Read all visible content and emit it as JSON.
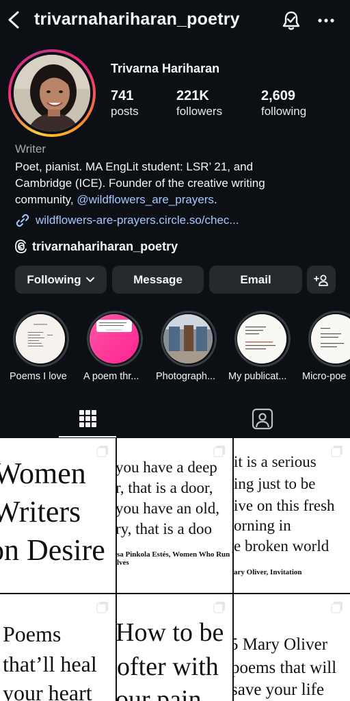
{
  "header": {
    "username": "trivarnahariharan_poetry"
  },
  "profile": {
    "display_name": "Trivarna Hariharan",
    "stats": [
      {
        "value": "741",
        "label": "posts"
      },
      {
        "value": "221K",
        "label": "followers"
      },
      {
        "value": "2,609",
        "label": "following"
      }
    ],
    "category": "Writer",
    "bio_lines": [
      "Poet, pianist. MA EngLit student: LSR’ 21, and",
      "Cambridge (ICE). Founder of the creative writing",
      "community, "
    ],
    "bio_mention": "@wildflowers_are_prayers",
    "bio_end": ".",
    "link": "wildflowers-are-prayers.circle.so/chec...",
    "threads_handle": "trivarnahariharan_poetry"
  },
  "actions": {
    "following": "Following",
    "message": "Message",
    "email": "Email"
  },
  "highlights": [
    {
      "label": "Poems I love"
    },
    {
      "label": "A poem thr..."
    },
    {
      "label": "Photograph..."
    },
    {
      "label": "My publicat..."
    },
    {
      "label": "Micro-poe"
    }
  ],
  "posts": [
    {
      "lines": [
        "Women",
        "Writers",
        "on Desire"
      ],
      "caption": ""
    },
    {
      "lines": [
        "you have a deep",
        "r, that is a door,",
        "you have an old,",
        "ry, that is a doo"
      ],
      "caption": "sa Pinkola Estés, Women Who Run Wit",
      "caption2": "lves"
    },
    {
      "lines": [
        "it is a serious",
        "ing just to be",
        "ive on this fresh",
        "orning in",
        "e broken world"
      ],
      "caption": "ary Oliver, Invitation"
    },
    {
      "lines": [
        "Poems",
        "that’ll heal",
        "your heart"
      ]
    },
    {
      "lines": [
        "How to be",
        "ofter with",
        "our pain"
      ]
    },
    {
      "lines": [
        "5 Mary Oliver",
        "poems that will",
        "save your life"
      ]
    }
  ],
  "colors": {
    "background": "#0c1014",
    "button": "#262a2e",
    "link": "#a6c8ff",
    "secondary_text": "#a8a8a8"
  }
}
